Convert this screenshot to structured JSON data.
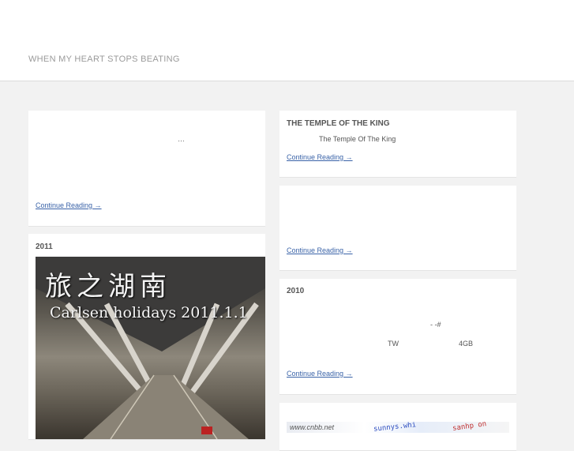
{
  "header": {
    "site_title": "WHEN MY HEART STOPS BEATING"
  },
  "posts": {
    "left_1": {
      "excerpt": "…",
      "more": "Continue Reading →"
    },
    "left_2": {
      "title": "2011",
      "image_line1": "旅之湖南",
      "image_line2": "Carlsen holidays 2011.1.1"
    },
    "right_1": {
      "title": "THE TEMPLE OF THE KING",
      "excerpt": "The Temple Of The King",
      "more": "Continue Reading →"
    },
    "right_2": {
      "more": "Continue Reading →"
    },
    "right_3": {
      "title": "2010",
      "line1": "- -#",
      "line2_a": "TW",
      "line2_b": "4GB",
      "more": "Continue Reading →"
    },
    "right_4": {
      "thumb_a": "www.cnbb.net",
      "thumb_b": "sunnys.whi",
      "thumb_c": "sanhp on"
    }
  }
}
